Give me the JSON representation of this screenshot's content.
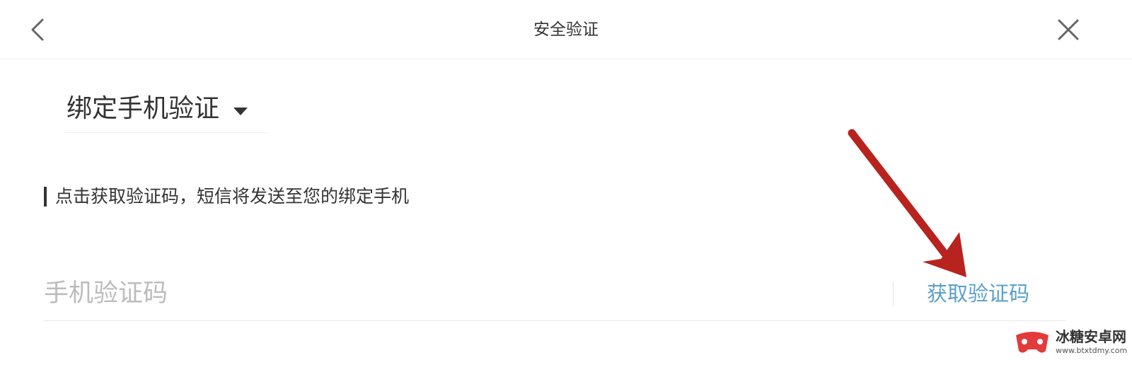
{
  "header": {
    "title": "安全验证",
    "back_icon": "chevron-left-icon",
    "close_icon": "close-icon"
  },
  "verification_method": {
    "selected": "绑定手机验证",
    "caret_icon": "caret-down-icon"
  },
  "hint": {
    "text": "点击获取验证码，短信将发送至您的绑定手机"
  },
  "code_field": {
    "placeholder": "手机验证码",
    "value": "",
    "get_code_label": "获取验证码"
  },
  "annotation": {
    "arrow_color": "#b8231f"
  },
  "watermark": {
    "name": "冰糖安卓网",
    "url": "www.btxtdmy.com"
  },
  "colors": {
    "accent": "#5aa0c8",
    "text": "#333333",
    "placeholder": "#bcbcbc",
    "divider": "#eeeeee"
  }
}
